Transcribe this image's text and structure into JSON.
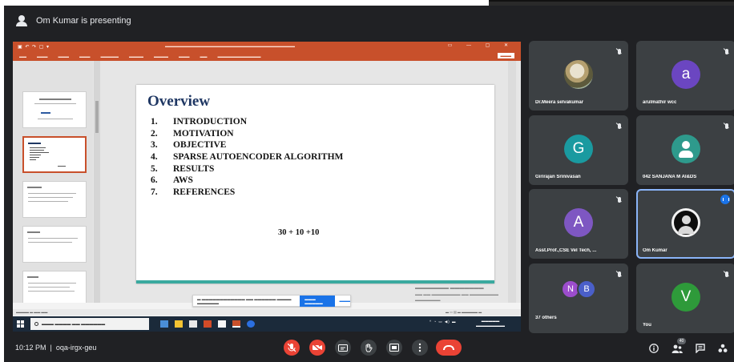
{
  "presenter_banner": {
    "text": "Om Kumar is presenting"
  },
  "slide": {
    "heading": "Overview",
    "agenda": [
      {
        "num": "1.",
        "label": "INTRODUCTION"
      },
      {
        "num": "2.",
        "label": "MOTIVATION"
      },
      {
        "num": "3.",
        "label": "OBJECTIVE"
      },
      {
        "num": "4.",
        "label": "SPARSE AUTOENCODER ALGORITHM"
      },
      {
        "num": "5.",
        "label": "RESULTS"
      },
      {
        "num": "6.",
        "label": "AWS"
      },
      {
        "num": "7.",
        "label": "REFERENCES"
      }
    ],
    "formula": "30 + 10 +10"
  },
  "participants": [
    {
      "name": "Dr.Meera selvakumar",
      "avatar_type": "photo",
      "muted": true
    },
    {
      "name": "arulmathir wcc",
      "initial": "a",
      "avatar_color": "#6b46c1",
      "muted": true
    },
    {
      "name": "Girirajan Srinivasan",
      "initial": "G",
      "avatar_color": "#1a9aa0",
      "muted": true
    },
    {
      "name": "042 SANJANA M AI&DS",
      "avatar_type": "user-icon",
      "muted": true
    },
    {
      "name": "Asst.Prof.,CSE Vel Tech, ...",
      "initial": "A",
      "avatar_color": "#7e57c2",
      "muted": true
    },
    {
      "name": "Om Kumar",
      "avatar_type": "user-icon",
      "speaking": true
    },
    {
      "name": "37 others",
      "mini_initials": [
        "N",
        "B"
      ],
      "mini_colors": [
        "#9c4dcc",
        "#4a5fc9"
      ],
      "muted": true
    },
    {
      "name": "You",
      "initial": "V",
      "avatar_color": "#2e9a3a",
      "muted": true
    }
  ],
  "bottom_bar": {
    "time": "10:12 PM",
    "separator": "|",
    "meeting_code": "oqa-irgx-geu"
  },
  "colors": {
    "meet_bg": "#202124",
    "tile_bg": "#3c4043",
    "ppt_accent": "#c8502b",
    "danger": "#ea4335",
    "speaking_outline": "#8ab4f8"
  },
  "icons": {
    "controls": [
      "mic-off-icon",
      "camera-off-icon",
      "captions-icon",
      "raise-hand-icon",
      "present-icon",
      "more-options-icon",
      "end-call-icon"
    ],
    "right": [
      "info-icon",
      "people-icon",
      "chat-icon",
      "activities-icon"
    ],
    "people_count": "40"
  }
}
